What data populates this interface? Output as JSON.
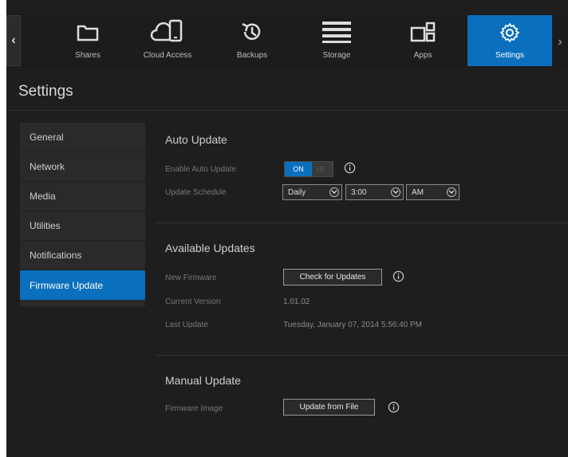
{
  "nav": {
    "items": [
      {
        "label": "Shares",
        "icon": "folder-icon"
      },
      {
        "label": "Cloud Access",
        "icon": "cloud-devices-icon"
      },
      {
        "label": "Backups",
        "icon": "history-icon"
      },
      {
        "label": "Storage",
        "icon": "storage-bars-icon"
      },
      {
        "label": "Apps",
        "icon": "apps-grid-icon"
      },
      {
        "label": "Settings",
        "icon": "gear-icon"
      }
    ],
    "active": "Settings"
  },
  "page": {
    "title": "Settings"
  },
  "sidebar": {
    "items": [
      {
        "label": "General"
      },
      {
        "label": "Network"
      },
      {
        "label": "Media"
      },
      {
        "label": "Utilities"
      },
      {
        "label": "Notifications"
      },
      {
        "label": "Firmware Update"
      }
    ],
    "active": "Firmware Update"
  },
  "auto_update": {
    "title": "Auto Update",
    "enable_label": "Enable Auto Update",
    "toggle_on": "ON",
    "toggle_grip": "III",
    "schedule_label": "Update Schedule",
    "frequency": "Daily",
    "time": "3:00",
    "ampm": "AM"
  },
  "available_updates": {
    "title": "Available Updates",
    "new_firmware_label": "New Firmware",
    "check_button": "Check for Updates",
    "current_version_label": "Current Version",
    "current_version": "1.01.02",
    "last_update_label": "Last Update",
    "last_update": "Tuesday, January 07, 2014 5:56:40 PM"
  },
  "manual_update": {
    "title": "Manual Update",
    "image_label": "Firmware Image",
    "update_button": "Update from File"
  },
  "colors": {
    "accent": "#0a6fbd",
    "background": "#1e1e1e"
  }
}
